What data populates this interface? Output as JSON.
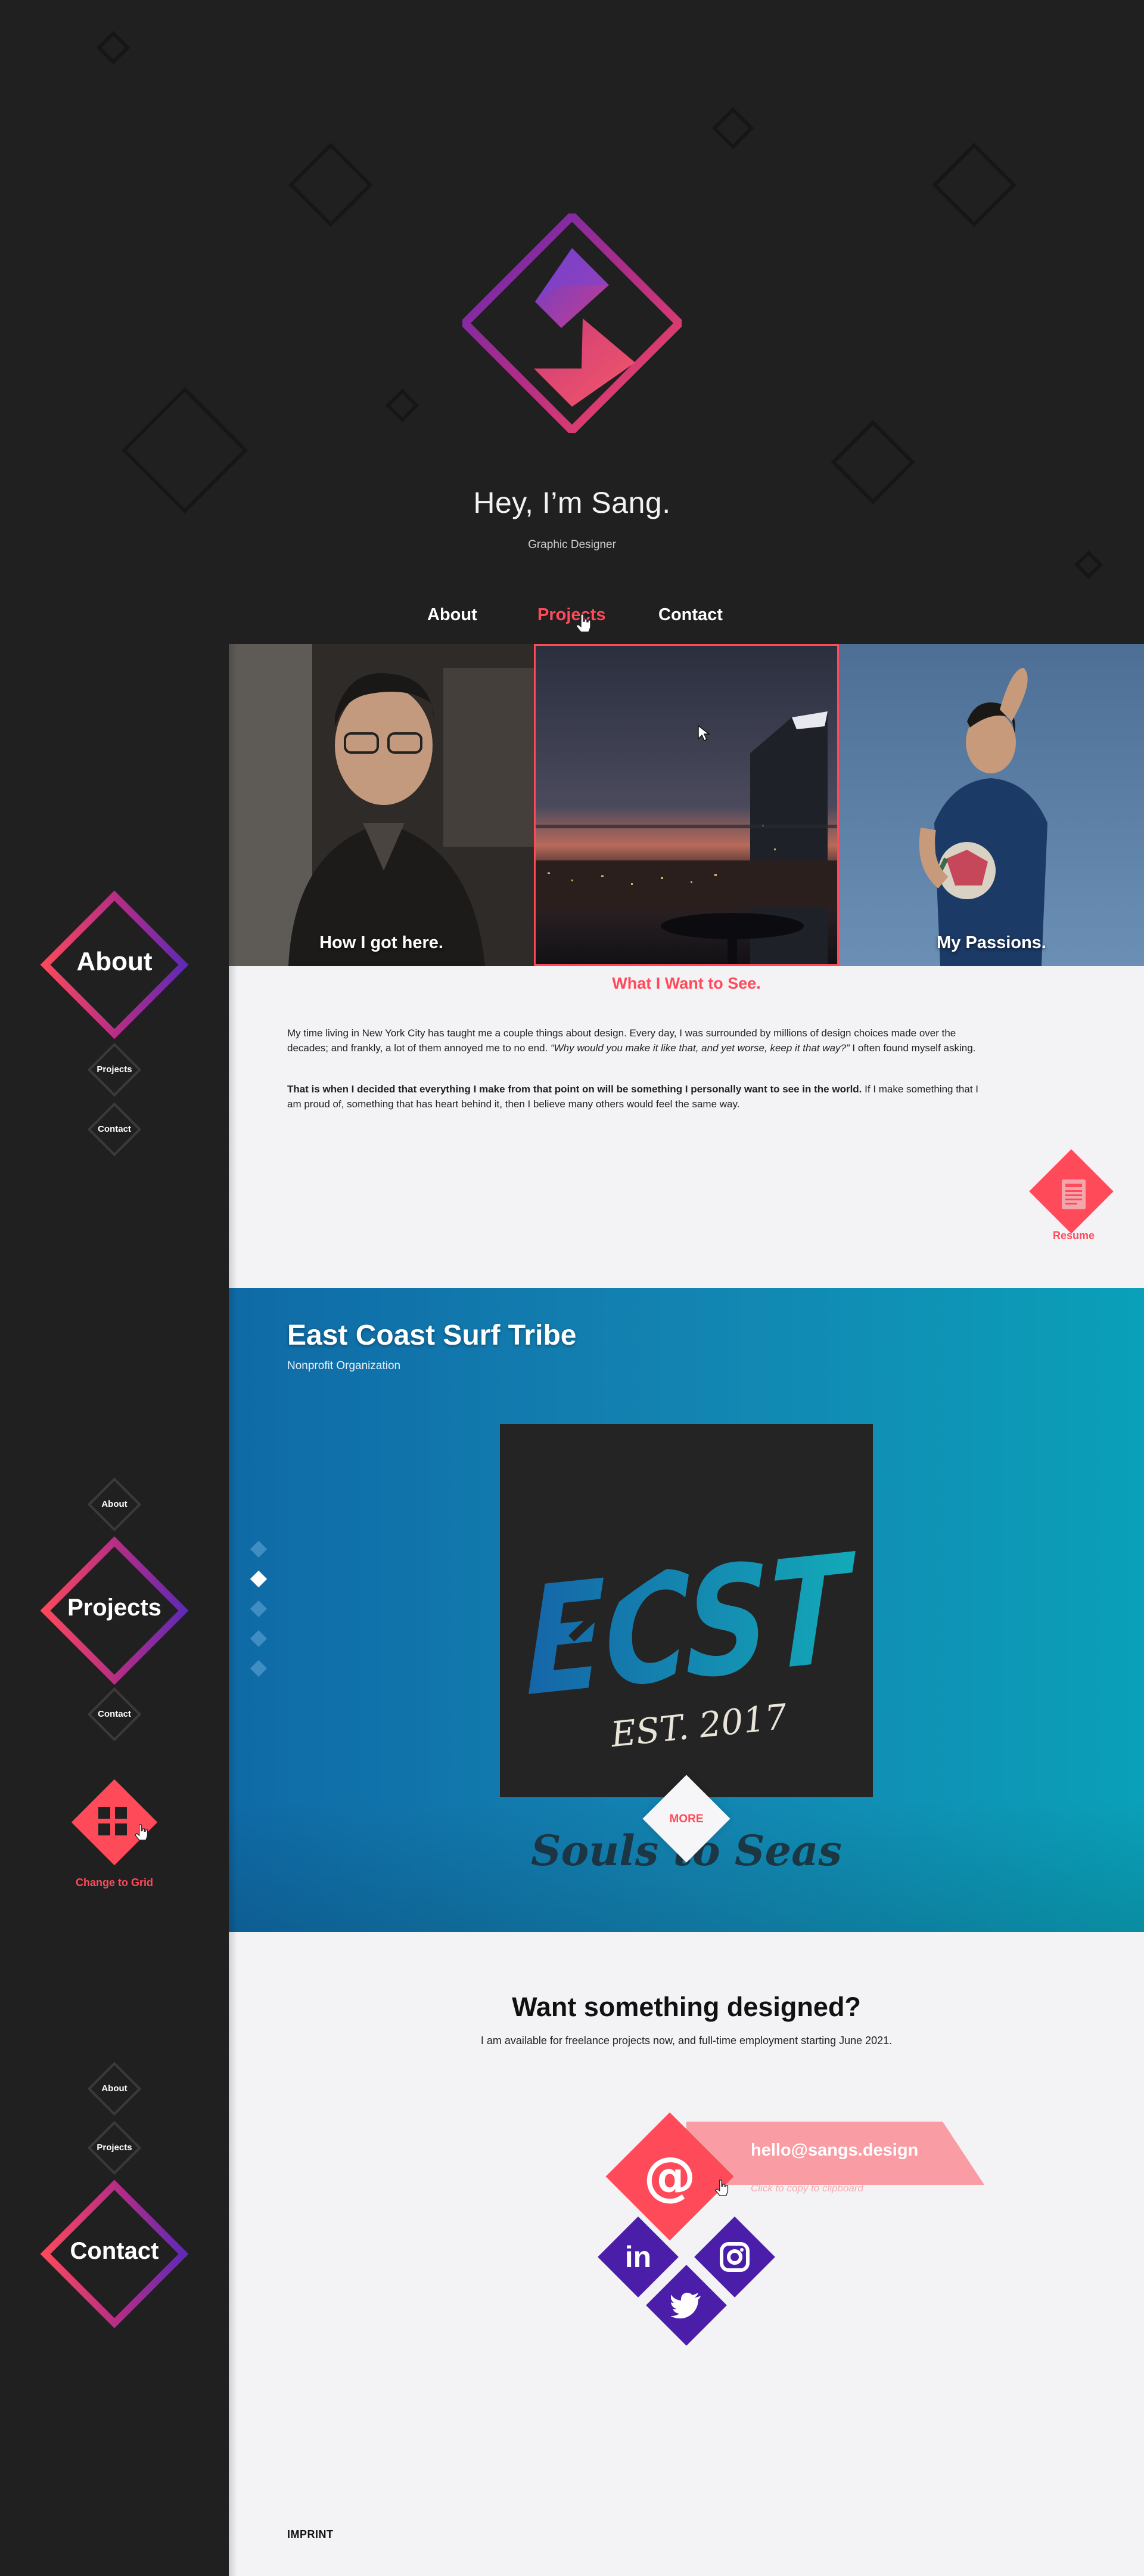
{
  "hero": {
    "title": "Hey, I’m Sang.",
    "subtitle": "Graphic Designer",
    "logo_icon": "s-logo-icon"
  },
  "nav": {
    "items": [
      {
        "label": "About",
        "active": false
      },
      {
        "label": "Projects",
        "active": true
      },
      {
        "label": "Contact",
        "active": false
      }
    ]
  },
  "sidebar": {
    "about_section": {
      "big": "About",
      "small": [
        "Projects",
        "Contact"
      ]
    },
    "projects_section": {
      "small_top": "About",
      "big": "Projects",
      "small_bottom": "Contact",
      "grid_button_label": "Change to Grid"
    },
    "contact_section": {
      "small": [
        "About",
        "Projects"
      ],
      "big": "Contact"
    }
  },
  "about": {
    "photos": [
      {
        "caption": "How I got here."
      },
      {
        "caption": ""
      },
      {
        "caption": "My Passions."
      }
    ],
    "heading": "What I Want to See.",
    "paragraph1_a": "My time living in New York City has taught me a couple things about design. Every day, I was surrounded by millions of design choices made over the decades; and frankly, a lot of them annoyed me to no end. ",
    "paragraph1_quote": "“Why would you make it like that, and yet worse, keep it that way?”",
    "paragraph1_b": " I often found myself asking.",
    "paragraph2_bold": "That is when I decided that everything I make from that point on will be something I personally want to see in the world.",
    "paragraph2_rest": " If I make something that I am proud of, something that has heart behind it, then I believe many others would feel the same way.",
    "resume_label": "Resume"
  },
  "project": {
    "title": "East Coast Surf Tribe",
    "subtitle": "Nonprofit Organization",
    "logo_text": "ECST",
    "logo_est": "EST. 2017",
    "more_label": "MORE",
    "tagline": "Souls to Seas",
    "slide_count": 5,
    "active_slide": 2
  },
  "contact": {
    "title": "Want something designed?",
    "subtitle": "I am available for freelance projects now, and full-time employment starting June 2021.",
    "email": "hello@sangs.design",
    "email_hint": "Click to copy to clipboard",
    "socials": [
      "linkedin-icon",
      "instagram-icon",
      "twitter-icon"
    ]
  },
  "footer": {
    "imprint": "IMPRINT"
  },
  "colors": {
    "accent": "#ff4a5a",
    "dark": "#202021",
    "purple": "#4a1ea8",
    "light": "#f3f3f5"
  }
}
